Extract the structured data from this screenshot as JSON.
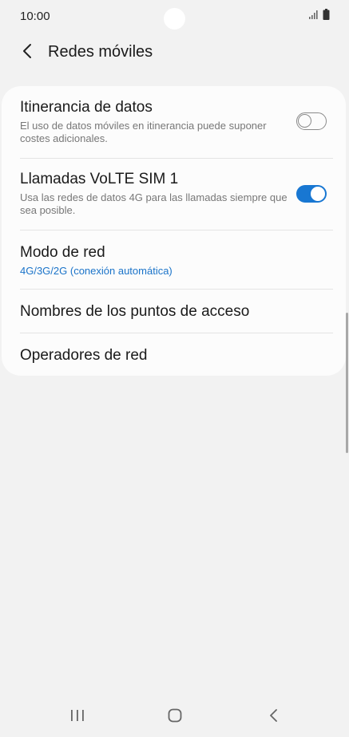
{
  "status_bar": {
    "time": "10:00",
    "icons": [
      "signal-icon",
      "battery-icon"
    ]
  },
  "header": {
    "back_icon": "chevron-left-icon",
    "title": "Redes móviles"
  },
  "settings": {
    "roaming": {
      "title": "Itinerancia de datos",
      "subtitle": "El uso de datos móviles en itinerancia puede suponer costes adicionales.",
      "toggle_on": false
    },
    "volte": {
      "title": "Llamadas VoLTE SIM 1",
      "subtitle": "Usa las redes de datos 4G para las llamadas siempre que sea posible.",
      "toggle_on": true
    },
    "network_mode": {
      "title": "Modo de red",
      "subtitle": "4G/3G/2G (conexión automática)"
    },
    "apn": {
      "title": "Nombres de los puntos de acceso"
    },
    "operators": {
      "title": "Operadores de red"
    }
  },
  "colors": {
    "accent": "#1877d2",
    "link_text": "#1a73c9",
    "background": "#f2f2f2",
    "card": "#fcfcfc"
  },
  "navigation_bar": {
    "icons": [
      "recent-apps-icon",
      "home-icon",
      "back-icon"
    ]
  }
}
